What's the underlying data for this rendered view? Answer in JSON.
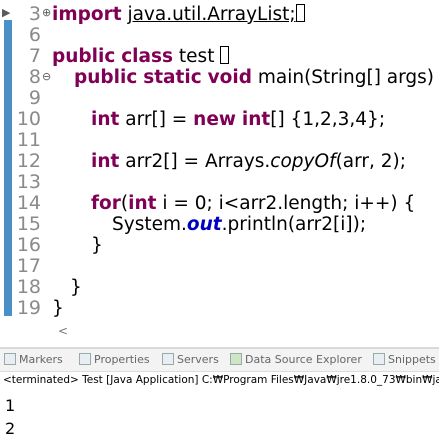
{
  "editor": {
    "line_numbers": [
      "3",
      "6",
      "7",
      "8",
      "9",
      "10",
      "11",
      "12",
      "13",
      "14",
      "15",
      "16",
      "17",
      "18",
      "19"
    ],
    "import_kw": "import",
    "import_path": "java.util.ArrayList;",
    "class_public": "public",
    "class_kw": "class",
    "class_name": "test",
    "main_public": "public",
    "main_static": "static",
    "main_void": "void",
    "main_sig": "main(String[] args) {",
    "l10_int": "int",
    "l10_mid": "arr[] = ",
    "l10_new": "new",
    "l10_int2": "int",
    "l10_rest": "[] {1,2,3,4};",
    "l12_int": "int",
    "l12_pre": "arr2[] = Arrays.",
    "l12_method": "copyOf",
    "l12_rest": "(arr, 2);",
    "l14_for": "for",
    "l14_paren": "(",
    "l14_int": "int",
    "l14_rest": "i = 0; i<arr2.length; i++) {",
    "l15_pre": "System.",
    "l15_out": "out",
    "l15_rest": ".println(arr2[i]);",
    "l16": "}",
    "l18": "}",
    "l19": "}"
  },
  "tabs": [
    {
      "label": "Markers"
    },
    {
      "label": "Properties"
    },
    {
      "label": "Servers"
    },
    {
      "label": "Data Source Explorer"
    },
    {
      "label": "Snippets"
    }
  ],
  "console": {
    "status": "<terminated> Test [Java Application] C:₩Program Files₩Java₩jre1.8.0_73₩bin₩ja",
    "output": [
      "1",
      "2"
    ]
  }
}
